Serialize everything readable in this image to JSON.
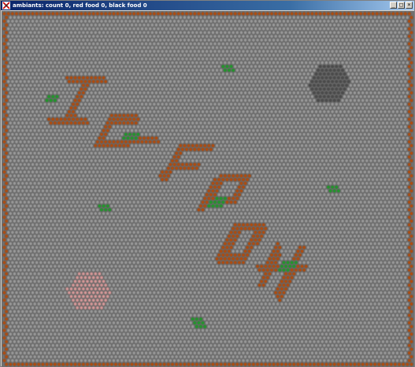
{
  "window": {
    "title": "ambiants: count 0, red food 0, black food 0",
    "icon": "ant-app-icon",
    "controls": [
      "minimize",
      "maximize",
      "close"
    ]
  },
  "board": {
    "columns": 101,
    "rows": 94,
    "colors": {
      "clear": "#9a9a9a",
      "cell_outline": "#5a5a5a",
      "rock": "#b34b0b",
      "food": "#1e9a28",
      "red_anthill": "#d89a9a",
      "black_anthill": "#4a4a4a"
    },
    "rock_text": "ICFP04",
    "ant_count": 0,
    "red_food": 0,
    "black_food": 0
  }
}
